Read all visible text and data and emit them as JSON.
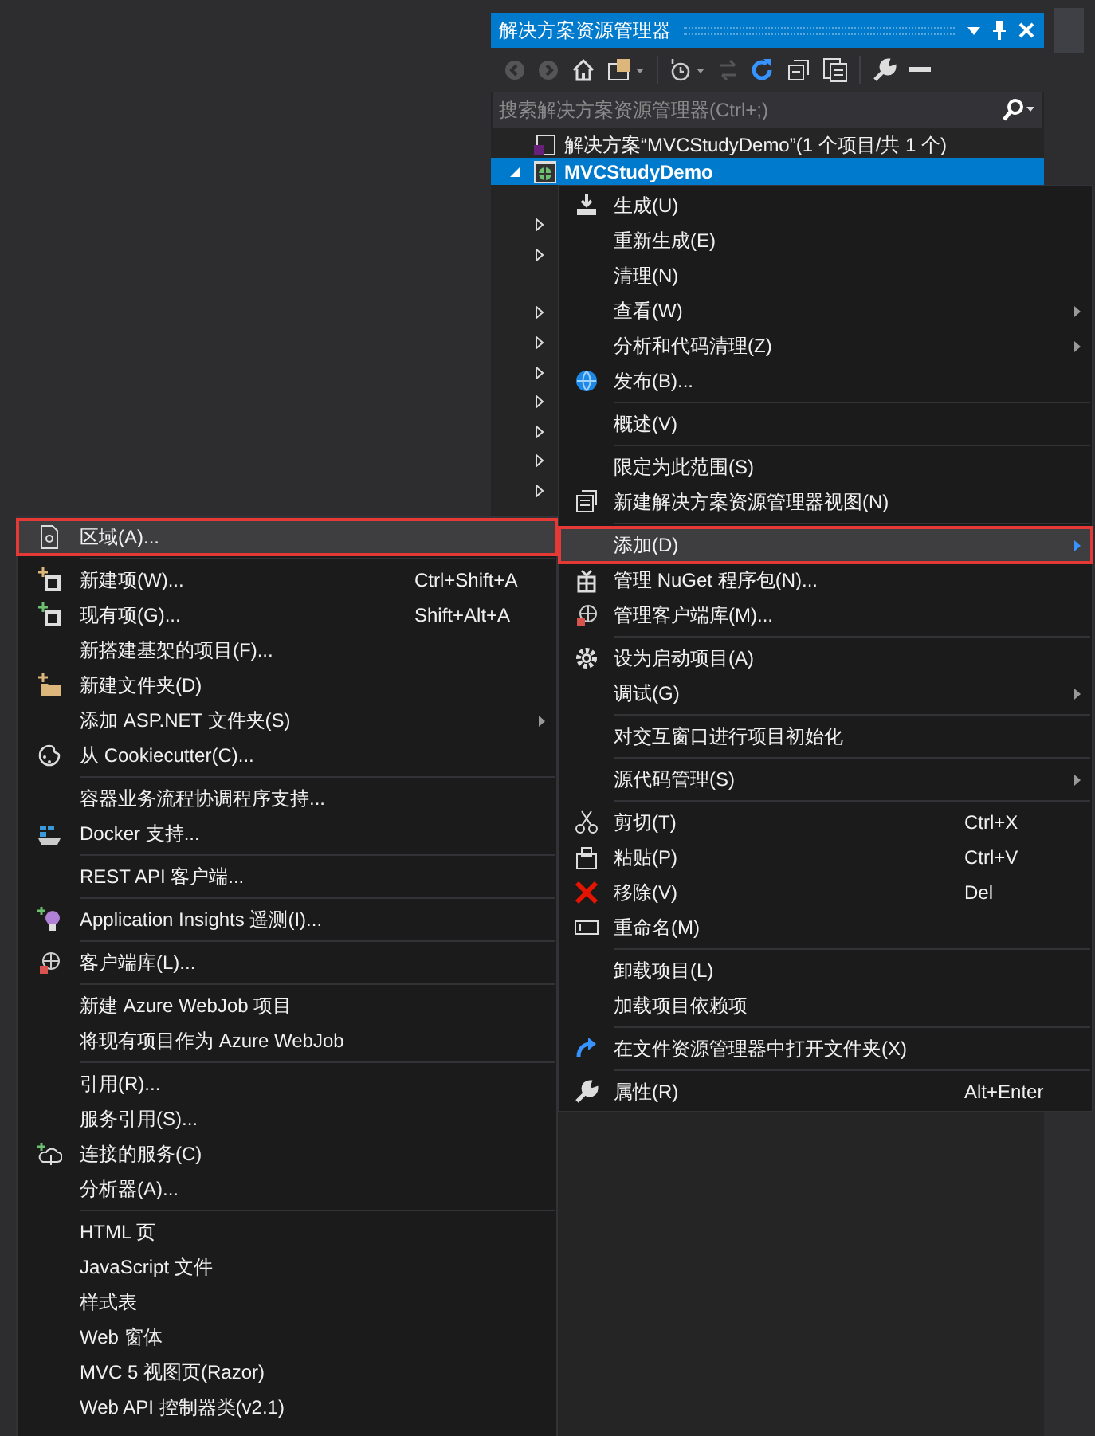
{
  "panel": {
    "title": "解决方案资源管理器",
    "search": {
      "placeholder": "搜索解决方案资源管理器(Ctrl+;)"
    },
    "tree": [
      {
        "label": "解决方案“MVCStudyDemo”(1 个项目/共 1 个)",
        "selected": false
      },
      {
        "label": "MVCStudyDemo",
        "selected": true,
        "expanded": true
      }
    ],
    "hidden_rows": [
      {
        "kind": "row",
        "expanded": false
      },
      {
        "kind": "row",
        "expanded": false
      },
      {
        "kind": "gap"
      },
      {
        "kind": "row",
        "expanded": false
      },
      {
        "kind": "row",
        "expanded": false
      },
      {
        "kind": "row",
        "expanded": false
      },
      {
        "kind": "row",
        "expanded": false
      },
      {
        "kind": "row",
        "expanded": false
      },
      {
        "kind": "row",
        "expanded": false
      },
      {
        "kind": "row",
        "expanded": false
      }
    ]
  },
  "context_menu": {
    "items": [
      {
        "kind": "item",
        "label": "生成(U)",
        "selected": false
      },
      {
        "kind": "item",
        "label": "重新生成(E)",
        "selected": false
      },
      {
        "kind": "item",
        "label": "清理(N)",
        "selected": false
      },
      {
        "kind": "submenu",
        "label": "查看(W)",
        "selected": false
      },
      {
        "kind": "submenu",
        "label": "分析和代码清理(Z)",
        "selected": false
      },
      {
        "kind": "item",
        "label": "发布(B)...",
        "selected": false
      },
      {
        "kind": "separator"
      },
      {
        "kind": "item",
        "label": "概述(V)",
        "selected": false
      },
      {
        "kind": "separator"
      },
      {
        "kind": "item",
        "label": "限定为此范围(S)",
        "selected": false
      },
      {
        "kind": "item",
        "label": "新建解决方案资源管理器视图(N)",
        "selected": false
      },
      {
        "kind": "separator"
      },
      {
        "kind": "submenu",
        "label": "添加(D)",
        "selected": true
      },
      {
        "kind": "item",
        "label": "管理 NuGet 程序包(N)...",
        "selected": false
      },
      {
        "kind": "item",
        "label": "管理客户端库(M)...",
        "selected": false
      },
      {
        "kind": "separator"
      },
      {
        "kind": "item",
        "label": "设为启动项目(A)",
        "selected": false
      },
      {
        "kind": "submenu",
        "label": "调试(G)",
        "selected": false
      },
      {
        "kind": "separator"
      },
      {
        "kind": "item",
        "label": "对交互窗口进行项目初始化",
        "selected": false
      },
      {
        "kind": "separator"
      },
      {
        "kind": "submenu",
        "label": "源代码管理(S)",
        "selected": false
      },
      {
        "kind": "separator"
      },
      {
        "kind": "item",
        "label": "剪切(T)",
        "shortcut": "Ctrl+X",
        "selected": false
      },
      {
        "kind": "item",
        "label": "粘贴(P)",
        "shortcut": "Ctrl+V",
        "selected": false
      },
      {
        "kind": "item",
        "label": "移除(V)",
        "shortcut": "Del",
        "selected": false
      },
      {
        "kind": "item",
        "label": "重命名(M)",
        "selected": false
      },
      {
        "kind": "separator"
      },
      {
        "kind": "item",
        "label": "卸载项目(L)",
        "selected": false
      },
      {
        "kind": "item",
        "label": "加载项目依赖项",
        "selected": false
      },
      {
        "kind": "separator"
      },
      {
        "kind": "item",
        "label": "在文件资源管理器中打开文件夹(X)",
        "selected": false
      },
      {
        "kind": "separator"
      },
      {
        "kind": "item",
        "label": "属性(R)",
        "shortcut": "Alt+Enter",
        "selected": false
      }
    ]
  },
  "add_submenu": {
    "items": [
      {
        "kind": "item",
        "label": "区域(A)...",
        "selected": true
      },
      {
        "kind": "separator"
      },
      {
        "kind": "item",
        "label": "新建项(W)...",
        "shortcut": "Ctrl+Shift+A",
        "selected": false
      },
      {
        "kind": "item",
        "label": "现有项(G)...",
        "shortcut": "Shift+Alt+A",
        "selected": false
      },
      {
        "kind": "item",
        "label": "新搭建基架的项目(F)...",
        "selected": false
      },
      {
        "kind": "item",
        "label": "新建文件夹(D)",
        "selected": false
      },
      {
        "kind": "submenu",
        "label": "添加 ASP.NET 文件夹(S)",
        "selected": false
      },
      {
        "kind": "item",
        "label": "从 Cookiecutter(C)...",
        "selected": false
      },
      {
        "kind": "separator"
      },
      {
        "kind": "item",
        "label": "容器业务流程协调程序支持...",
        "selected": false
      },
      {
        "kind": "item",
        "label": "Docker 支持...",
        "selected": false
      },
      {
        "kind": "separator"
      },
      {
        "kind": "item",
        "label": "REST API 客户端...",
        "selected": false
      },
      {
        "kind": "separator"
      },
      {
        "kind": "item",
        "label": "Application Insights 遥测(I)...",
        "selected": false
      },
      {
        "kind": "separator"
      },
      {
        "kind": "item",
        "label": "客户端库(L)...",
        "selected": false
      },
      {
        "kind": "separator"
      },
      {
        "kind": "item",
        "label": "新建 Azure WebJob 项目",
        "selected": false
      },
      {
        "kind": "item",
        "label": "将现有项目作为 Azure WebJob",
        "selected": false
      },
      {
        "kind": "separator"
      },
      {
        "kind": "item",
        "label": "引用(R)...",
        "selected": false
      },
      {
        "kind": "item",
        "label": "服务引用(S)...",
        "selected": false
      },
      {
        "kind": "item",
        "label": "连接的服务(C)",
        "selected": false
      },
      {
        "kind": "item",
        "label": "分析器(A)...",
        "selected": false
      },
      {
        "kind": "separator"
      },
      {
        "kind": "item",
        "label": "HTML 页",
        "selected": false
      },
      {
        "kind": "item",
        "label": "JavaScript 文件",
        "selected": false
      },
      {
        "kind": "item",
        "label": "样式表",
        "selected": false
      },
      {
        "kind": "item",
        "label": "Web 窗体",
        "selected": false
      },
      {
        "kind": "item",
        "label": "MVC 5 视图页(Razor)",
        "selected": false
      },
      {
        "kind": "item",
        "label": "Web API 控制器类(v2.1)",
        "selected": false
      }
    ]
  }
}
